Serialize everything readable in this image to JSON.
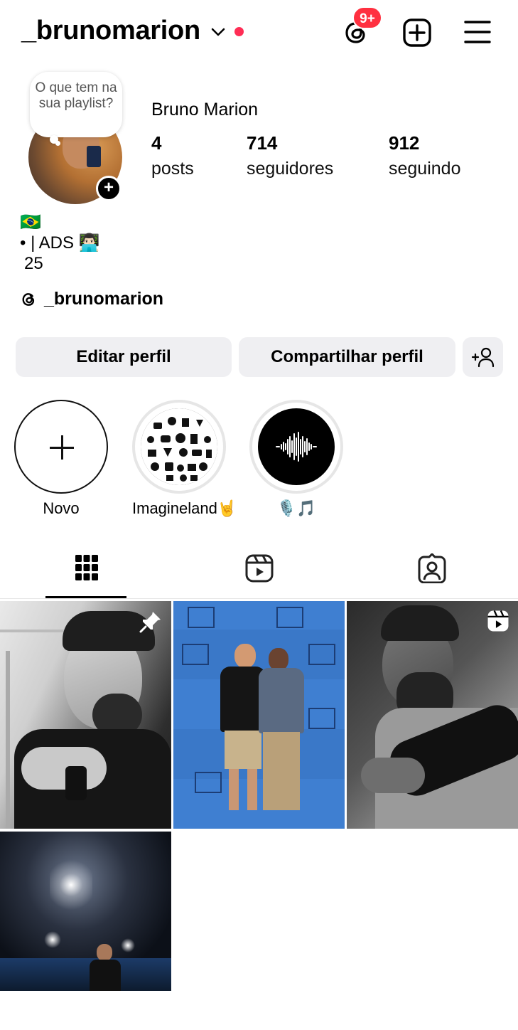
{
  "header": {
    "username": "_brunomarion",
    "threads_badge": "9+"
  },
  "profile": {
    "note_bubble": "O que tem na sua playlist?",
    "full_name": "Bruno Marion",
    "stats": [
      {
        "value": "4",
        "label": "posts"
      },
      {
        "value": "714",
        "label": "seguidores"
      },
      {
        "value": "912",
        "label": "seguindo"
      }
    ],
    "bio_lines": [
      "🇧🇷",
      "• | ADS 👨🏻‍💻",
      "25"
    ],
    "threads_handle": "_brunomarion"
  },
  "actions": {
    "edit_label": "Editar perfil",
    "share_label": "Compartilhar perfil"
  },
  "highlights": [
    {
      "label": "Novo"
    },
    {
      "label": "Imagineland🤘"
    },
    {
      "label": "🎙️🎵"
    }
  ],
  "tabs": {
    "active": "posts-grid"
  },
  "grid": {
    "posts": [
      {
        "type": "pinned-photo"
      },
      {
        "type": "photo"
      },
      {
        "type": "reel"
      },
      {
        "type": "photo"
      }
    ]
  },
  "colors": {
    "badge": "#ff3040",
    "button_bg": "#efeff2",
    "status_dot": "#ff2d55"
  }
}
